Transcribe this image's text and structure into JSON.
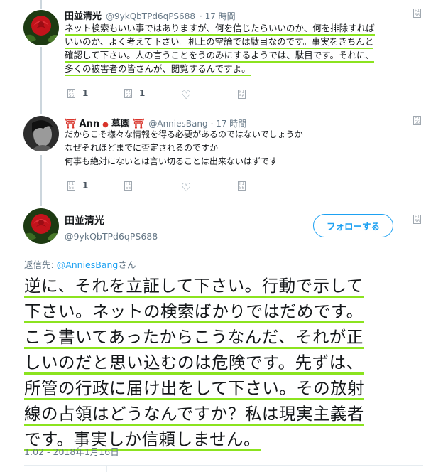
{
  "tweet1": {
    "name": "田並清光",
    "handle": "@9ykQbTPd6qPS688",
    "time": "· 17 時間",
    "lines": [
      "ネット検索もいい事ではありますが、何を信じたらいいのか、何を排除すれば",
      "いいのか、よく考えて下さい。机上の空論では駄目なのです。事実をきちんと",
      "確認して下さい。人の言うことをうのみにするようでは、駄目です。それに、",
      "多くの被害者の皆さんが、閲覧するんですよ。"
    ],
    "reply_count": "1",
    "retweet_count": "1"
  },
  "tweet2": {
    "name_prefix_icon": "⛩",
    "name": "Ann",
    "name_dot": "●",
    "name_suffix": "墓園",
    "name_suffix_icon": "⛩",
    "handle": "@AnniesBang",
    "time": "· 17 時間",
    "lines": [
      "だからこそ様々な情報を得る必要があるのではないでしょうか",
      "なぜそれほどまでに否定されるのですか",
      "何事も絶対にないとは言い切ることは出来ないはずです"
    ],
    "reply_count": "1"
  },
  "main": {
    "name": "田並清光",
    "handle": "@9ykQbTPd6qPS688",
    "follow_label": "フォローする",
    "reply_to_prefix": "返信先: ",
    "reply_to_user": "@AnniesBang",
    "reply_to_suffix": "さん",
    "lines": [
      "逆に、それを立証して下さい。行動で示して",
      "下さい。ネットの検索ばかりではだめです。",
      "こう書いてあったからこうなんだ、それが正",
      "しいのだと思い込むのは危険です。先ずは、",
      "所管の行政に届け出をして下さい。その放射",
      "線の占領はどうなんですか？私は現実主義者",
      "です。事実しか信頼しません。"
    ],
    "timestamp": "1:02 - 2018年1月16日"
  },
  "icons": {
    "reply": "reply-icon",
    "retweet": "retweet-icon",
    "like": "heart-icon",
    "dm": "message-icon",
    "caret": "caret-icon"
  },
  "colors": {
    "accent": "#1da1f2",
    "highlight": "#8be31f",
    "muted": "#657786",
    "avatar_red": "#c3131b"
  }
}
